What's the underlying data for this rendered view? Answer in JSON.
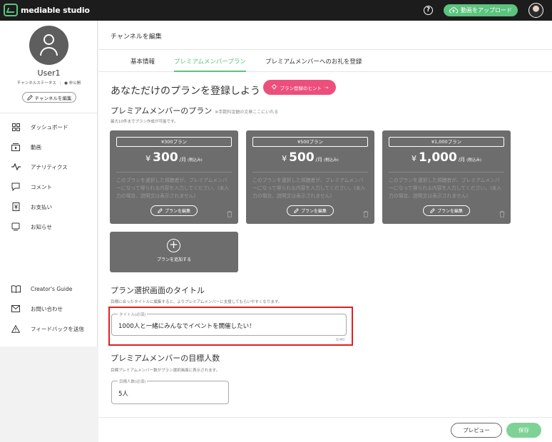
{
  "header": {
    "logo_text": "mediable studio",
    "help_glyph": "?",
    "upload_label": "動画をアップロード"
  },
  "sidebar": {
    "username": "User1",
    "status_label": "チャンネルステータス",
    "status_value": "非公開",
    "edit_channel": "チャンネルを編集",
    "nav": [
      {
        "label": "ダッシュボード",
        "icon": "dashboard-icon"
      },
      {
        "label": "動画",
        "icon": "video-icon"
      },
      {
        "label": "アナリティクス",
        "icon": "analytics-icon"
      },
      {
        "label": "コメント",
        "icon": "comment-icon"
      },
      {
        "label": "お支払い",
        "icon": "payment-icon"
      },
      {
        "label": "お知らせ",
        "icon": "notice-icon"
      }
    ],
    "nav_bottom": [
      {
        "label": "Creator's Guide",
        "icon": "book-icon"
      },
      {
        "label": "お問い合わせ",
        "icon": "mail-icon"
      },
      {
        "label": "フィードバックを送信",
        "icon": "warning-icon"
      }
    ]
  },
  "main": {
    "page_title": "チャンネルを編集",
    "tabs": [
      {
        "label": "基本情報",
        "active": false
      },
      {
        "label": "プレミアムメンバープラン",
        "active": true
      },
      {
        "label": "プレミアムメンバーへのお礼を登録",
        "active": false
      }
    ],
    "heading": "あなただけのプランを登録しよう",
    "hint_button": "プラン登録のヒント",
    "plans_heading": "プレミアムメンバーのプラン",
    "plans_note": "※手数料金額の文章ここにいれる",
    "plans_desc": "最大10件までプラン作成が可能です。",
    "plans": [
      {
        "name": "¥300プラン",
        "yen": "¥",
        "amount": "300",
        "unit": "/月",
        "tax": "(税込み)",
        "desc": "このプランを選択した視聴者が、プレミアムメンバーになって得られる内容を入力してください。(未入力の場合、説明文は表示されません)",
        "edit": "プランを編集"
      },
      {
        "name": "¥500プラン",
        "yen": "¥",
        "amount": "500",
        "unit": "/月",
        "tax": "(税込み)",
        "desc": "このプランを選択した視聴者が、プレミアムメンバーになって得られる内容を入力してください。(未入力の場合、説明文は表示されません)",
        "edit": "プランを編集"
      },
      {
        "name": "¥1,000プラン",
        "yen": "¥",
        "amount": "1,000",
        "unit": "/月",
        "tax": "(税込み)",
        "desc": "このプランを選択した視聴者が、プレミアムメンバーになって得られる内容を入力してください。(未入力の場合、説明文は表示されません)",
        "edit": "プランを編集"
      }
    ],
    "add_plan": "プランを追加する",
    "title_section": "プラン選択画面のタイトル",
    "title_desc": "目標に合ったタイトルに編集すると、よりプレミアムメンバーに支援してもらいやすくなります。",
    "title_field_label": "タイトル(必須)",
    "title_field_value": "1000人と一緒にみんなでイベントを開催したい！",
    "title_counter": "0/40",
    "target_section": "プレミアムメンバーの目標人数",
    "target_desc": "目標プレミアムメンバー数がプラン選択画面に表示されます。",
    "target_field_label": "目標人数(必須)",
    "target_field_value": "5人"
  },
  "footer": {
    "preview": "プレビュー",
    "save": "保存"
  },
  "colors": {
    "accent": "#5cc37e",
    "hint": "#ec4f7c",
    "card": "#6d6d6d",
    "highlight": "#e02020"
  }
}
